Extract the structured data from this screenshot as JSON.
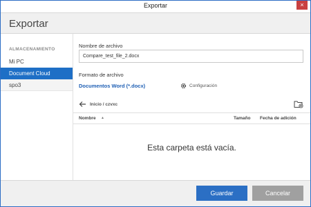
{
  "window": {
    "title": "Exportar",
    "close_glyph": "×"
  },
  "header": {
    "title": "Exportar"
  },
  "sidebar": {
    "section_label": "ALMACENAMIENTO",
    "items": [
      {
        "label": "Mi PC"
      },
      {
        "label": "Document Cloud",
        "selected": true
      },
      {
        "label": "spo3"
      }
    ]
  },
  "form": {
    "filename_label": "Nombre de archivo",
    "filename_value": "Compare_test_file_2.docx",
    "format_label": "Formato de archivo",
    "format_value": "Documentos Word (*.docx)",
    "settings_label": "Configuración"
  },
  "browser": {
    "breadcrumb": "Inicio / czvxc",
    "columns": {
      "name": "Nombre",
      "size": "Tamaño",
      "date": "Fecha de adición"
    },
    "sort_indicator": "▲",
    "empty_message": "Esta carpeta está vacía."
  },
  "footer": {
    "save_label": "Guardar",
    "cancel_label": "Cancelar"
  },
  "colors": {
    "accent": "#1e6fc6",
    "link": "#1e5fb4",
    "close": "#c94141",
    "disabled_button": "#a0a0a0"
  },
  "icons": [
    "close-icon",
    "back-arrow-icon",
    "gear-icon",
    "new-folder-icon",
    "sort-ascending-icon",
    "mouse-cursor-icon"
  ]
}
